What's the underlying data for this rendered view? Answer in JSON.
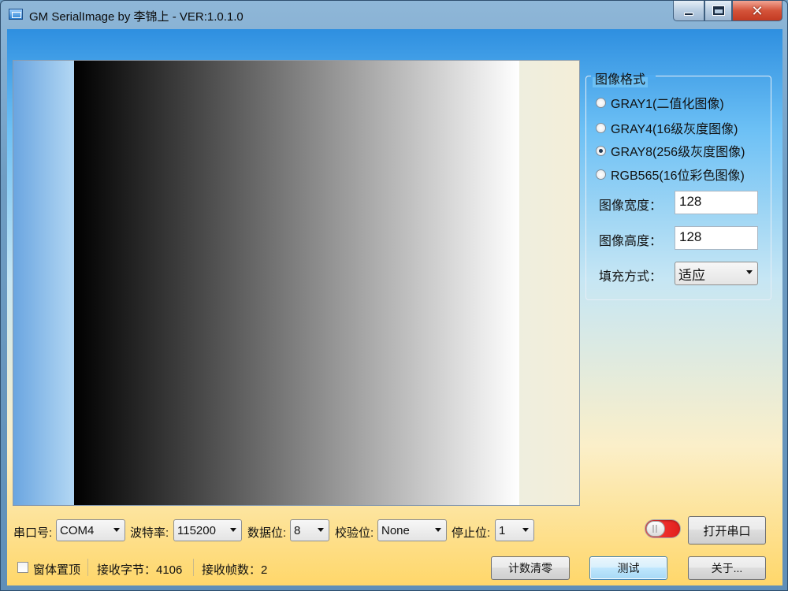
{
  "window": {
    "title": "GM SerialImage by 李锦上 - VER:1.0.1.0"
  },
  "format_group": {
    "title": "图像格式",
    "options": [
      {
        "label": "GRAY1(二值化图像)",
        "checked": false
      },
      {
        "label": "GRAY4(16级灰度图像)",
        "checked": false
      },
      {
        "label": "GRAY8(256级灰度图像)",
        "checked": true
      },
      {
        "label": "RGB565(16位彩色图像)",
        "checked": false
      }
    ],
    "width_label": "图像宽度：",
    "width_value": "128",
    "height_label": "图像高度：",
    "height_value": "128",
    "fill_label": "填充方式：",
    "fill_value": "适应"
  },
  "serial": {
    "port_label": "串口号:",
    "port_value": "COM4",
    "baud_label": "波特率:",
    "baud_value": "115200",
    "databits_label": "数据位:",
    "databits_value": "8",
    "parity_label": "校验位:",
    "parity_value": "None",
    "stopbits_label": "停止位:",
    "stopbits_value": "1",
    "open_button": "打开串口"
  },
  "status": {
    "topmost_label": "窗体置顶",
    "bytes_label": "接收字节：4106",
    "frames_label": "接收帧数：2"
  },
  "buttons": {
    "clear_counts": "计数清零",
    "test": "测试",
    "about": "关于..."
  },
  "colors": {
    "toggle_on": "#e0201c",
    "focus_border": "#3c7fb1"
  }
}
